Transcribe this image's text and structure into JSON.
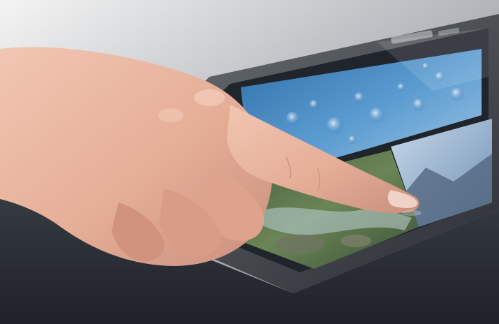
{
  "scene": {
    "subject": "hand-touching-display",
    "palette": {
      "background_light": "#f2f2f2",
      "background_mid": "#9a9da2",
      "device_body": "#2b2f36",
      "device_edge": "#55595f",
      "water_blue": "#4f8fc4",
      "water_highlight": "#b9d9ef",
      "forest_green": "#5e7a4e",
      "rock_grey": "#7a7f6a",
      "sky_tile": "#9db7d3",
      "skin": "#e8b6a2",
      "skin_shadow": "#c98f7b"
    }
  },
  "device": {
    "brand_mark_text": "",
    "tiles": [
      {
        "name": "water-drops-tile"
      },
      {
        "name": "forest-stream-tile"
      },
      {
        "name": "mountain-sky-tile"
      }
    ]
  }
}
